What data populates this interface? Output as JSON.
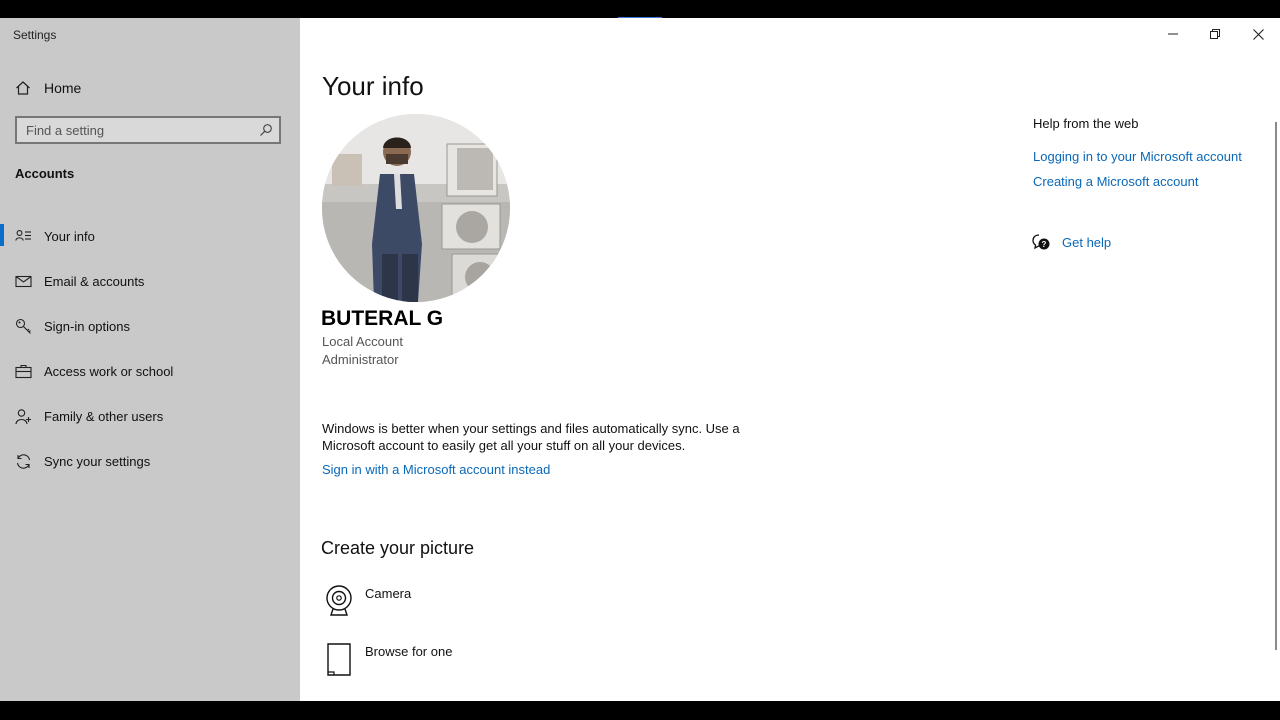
{
  "window": {
    "title": "Settings",
    "controls": [
      "minimize",
      "restore",
      "close"
    ]
  },
  "sidebar": {
    "home_label": "Home",
    "search_placeholder": "Find a setting",
    "section_title": "Accounts",
    "items": [
      {
        "label": "Your info",
        "icon": "person-list-icon",
        "active": true
      },
      {
        "label": "Email & accounts",
        "icon": "mail-icon",
        "active": false
      },
      {
        "label": "Sign-in options",
        "icon": "key-icon",
        "active": false
      },
      {
        "label": "Access work or school",
        "icon": "briefcase-icon",
        "active": false
      },
      {
        "label": "Family & other users",
        "icon": "person-add-icon",
        "active": false
      },
      {
        "label": "Sync your settings",
        "icon": "sync-icon",
        "active": false
      }
    ]
  },
  "main": {
    "title": "Your info",
    "user_name": "BUTERAL G",
    "account_type": "Local Account",
    "account_role": "Administrator",
    "sync_message": "Windows is better when your settings and files automatically sync. Use a Microsoft account to easily get all your stuff on all your devices.",
    "signin_link": "Sign in with a Microsoft account instead",
    "create_picture_title": "Create your picture",
    "picture_options": [
      {
        "label": "Camera",
        "icon": "camera-icon"
      },
      {
        "label": "Browse for one",
        "icon": "file-icon"
      }
    ]
  },
  "help": {
    "title": "Help from the web",
    "links": [
      "Logging in to your Microsoft account",
      "Creating a Microsoft account"
    ],
    "get_help": "Get help"
  },
  "colors": {
    "sidebar_bg": "#c9c9c9",
    "accent": "#0a6ec9",
    "link": "#0a68b8"
  }
}
